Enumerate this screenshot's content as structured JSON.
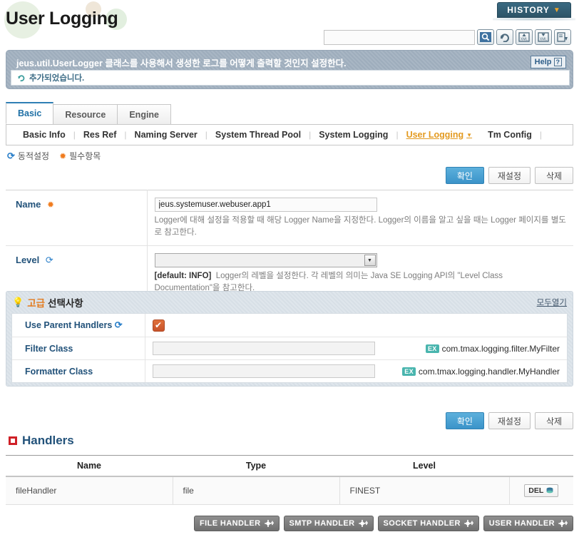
{
  "page": {
    "title": "User Logging"
  },
  "header": {
    "history_label": "HISTORY",
    "history_caret": "chevron-down-icon",
    "search_value": "",
    "search_placeholder": "",
    "toolbar_icons": [
      {
        "name": "search-icon",
        "label": "Search"
      },
      {
        "name": "refresh-icon",
        "label": "Reload"
      },
      {
        "name": "xml-import-icon",
        "label": "XML Import"
      },
      {
        "name": "xml-export-icon",
        "label": "XML Export"
      },
      {
        "name": "save-export-icon",
        "label": "Export"
      }
    ]
  },
  "banner": {
    "description": "jeus.util.UserLogger 클래스를 사용해서 생성한 로그를 어떻게 출력할 것인지 설정한다.",
    "help_label": "Help",
    "help_mark": "?",
    "status_message": "추가되었습니다.",
    "status_icon": "refresh-icon"
  },
  "tabs": [
    {
      "label": "Basic",
      "active": true
    },
    {
      "label": "Resource",
      "active": false
    },
    {
      "label": "Engine",
      "active": false
    }
  ],
  "subnav": [
    {
      "label": "Basic Info",
      "active": false
    },
    {
      "label": "Res Ref",
      "active": false
    },
    {
      "label": "Naming Server",
      "active": false
    },
    {
      "label": "System Thread Pool",
      "active": false
    },
    {
      "label": "System Logging",
      "active": false
    },
    {
      "label": "User Logging",
      "active": true
    },
    {
      "label": "Tm Config",
      "active": false
    }
  ],
  "legend": [
    {
      "icon": "dynamic-config-icon",
      "label": "동적설정"
    },
    {
      "icon": "required-field-icon",
      "label": "필수항목"
    }
  ],
  "actions": {
    "confirm": "확인",
    "reset": "재설정",
    "delete": "삭제"
  },
  "form": {
    "name": {
      "label": "Name",
      "required_icon": "required-field-icon",
      "value": "jeus.systemuser.webuser.app1",
      "description": "Logger에 대해 설정을 적용할 때 해당 Logger Name을 지정한다. Logger의 이름을 알고 싶을 때는 Logger 페이지를 별도로 참고한다."
    },
    "level": {
      "label": "Level",
      "dynamic_icon": "dynamic-config-icon",
      "value": "",
      "default_label": "[default: INFO]",
      "description": "Logger의 레벨을 설정한다. 각 레벨의 의미는 Java SE Logging API의 \"Level Class Documentation\"을 참고한다."
    }
  },
  "advanced": {
    "bulb_icon": "lightbulb-icon",
    "title_accent": "고급",
    "title_rest": "선택사항",
    "open_all": "모두열기",
    "rows": [
      {
        "label": "Use Parent Handlers",
        "dynamic_icon": "dynamic-config-icon",
        "type": "checkbox",
        "checked": true,
        "check_glyph": "✔"
      },
      {
        "label": "Filter Class",
        "type": "text",
        "value": "",
        "ex_badge": "EX",
        "ex_text": "com.tmax.logging.filter.MyFilter"
      },
      {
        "label": "Formatter Class",
        "type": "text",
        "value": "",
        "ex_badge": "EX",
        "ex_text": "com.tmax.logging.handler.MyHandler"
      }
    ]
  },
  "handlers": {
    "section_title": "Handlers",
    "section_icon": "square-bullet-icon",
    "columns": [
      "Name",
      "Type",
      "Level",
      ""
    ],
    "rows": [
      {
        "name": "fileHandler",
        "type": "file",
        "level": "FINEST",
        "action": "DEL"
      }
    ],
    "del_label": "DEL",
    "del_icon": "trash-icon"
  },
  "bottom_buttons": [
    {
      "label": "FILE HANDLER",
      "icon": "add-icon"
    },
    {
      "label": "SMTP HANDLER",
      "icon": "add-icon"
    },
    {
      "label": "SOCKET HANDLER",
      "icon": "add-icon"
    },
    {
      "label": "USER HANDLER",
      "icon": "add-icon"
    }
  ],
  "colors": {
    "accent_blue": "#22527a",
    "primary_button": "#3b93c9",
    "required_orange": "#f07c1e",
    "active_subnav": "#e39a20",
    "ex_badge_teal": "#49b5ae",
    "checkbox_orange": "#c7522a",
    "handler_red": "#cf2027"
  }
}
